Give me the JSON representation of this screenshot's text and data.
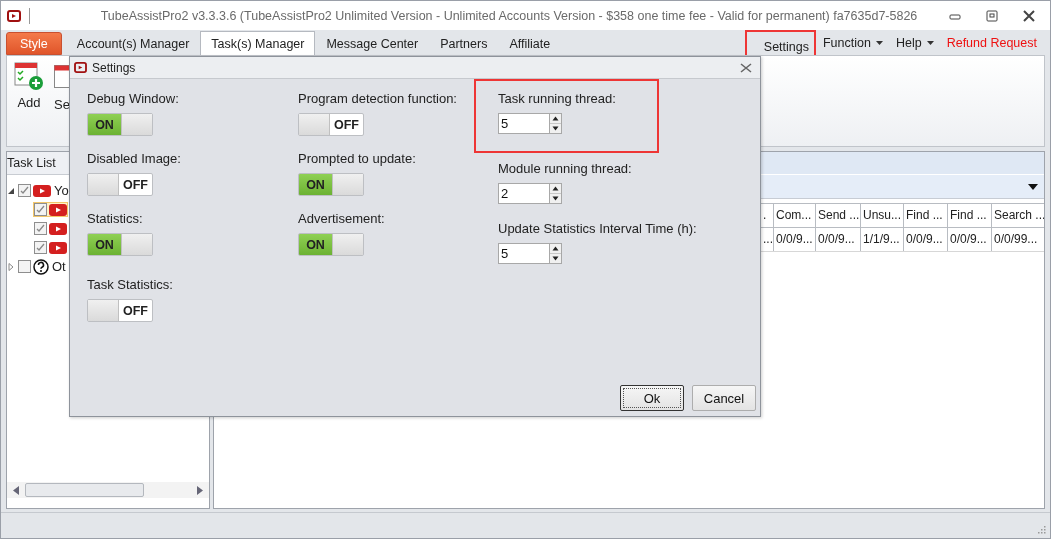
{
  "window": {
    "title": "TubeAssistPro2 v3.3.3.6 (TubeAssistPro2 Unlimited Version - Unlimited Accounts Version - $358 one time fee - Valid for permanent) fa7635d7-5826"
  },
  "app_menu": {
    "label": "Style"
  },
  "tabs": [
    {
      "label": "Account(s) Manager",
      "kind": "normal",
      "selected": false
    },
    {
      "label": "Task(s) Manager",
      "kind": "normal",
      "selected": true
    },
    {
      "label": "Message Center",
      "kind": "normal",
      "selected": false
    },
    {
      "label": "Partners",
      "kind": "normal",
      "selected": false
    },
    {
      "label": "Affiliate",
      "kind": "normal",
      "selected": false
    }
  ],
  "menu": [
    {
      "label": "Settings",
      "kind": "plain",
      "highlighted": true
    },
    {
      "label": "Function",
      "kind": "dropdown",
      "highlighted": false
    },
    {
      "label": "Help",
      "kind": "dropdown",
      "highlighted": false
    },
    {
      "label": "Refund Request",
      "kind": "alert",
      "highlighted": false
    }
  ],
  "ribbon": {
    "buttons": [
      {
        "label": "Add",
        "kind": "add"
      },
      {
        "label": "Se",
        "kind": "other"
      }
    ]
  },
  "task_list": {
    "title": "Task List",
    "items": [
      {
        "label": "Yo",
        "kind": "video",
        "checked": true,
        "expanded": true,
        "selected": false,
        "children": [
          {
            "kind": "video",
            "checked": true,
            "selected": true
          },
          {
            "kind": "video",
            "checked": true,
            "selected": false
          },
          {
            "kind": "video",
            "checked": true,
            "selected": false
          }
        ]
      },
      {
        "label": "Ot",
        "kind": "unknown",
        "checked": false,
        "expanded": false,
        "selected": false
      }
    ]
  },
  "table": {
    "columns": [
      ".",
      "Com...",
      "Send ...",
      "Unsu...",
      "Find ...",
      "Find ...",
      "Search ..."
    ],
    "rows": [
      [
        "...",
        "0/0/9...",
        "0/0/9...",
        "1/1/9...",
        "0/0/9...",
        "0/0/9...",
        "0/0/99..."
      ]
    ]
  },
  "dialog": {
    "title": "Settings",
    "columns": [
      [
        {
          "kind": "toggle",
          "label": "Debug Window:",
          "on": true,
          "state_text": "ON"
        },
        {
          "kind": "toggle",
          "label": "Disabled Image:",
          "on": false,
          "state_text": "OFF"
        },
        {
          "kind": "toggle",
          "label": "Statistics:",
          "on": true,
          "state_text": "ON"
        },
        {
          "kind": "toggle",
          "label": "Task Statistics:",
          "on": false,
          "state_text": "OFF"
        }
      ],
      [
        {
          "kind": "toggle",
          "label": "Program detection function:",
          "on": false,
          "state_text": "OFF"
        },
        {
          "kind": "toggle",
          "label": "Prompted to update:",
          "on": true,
          "state_text": "ON"
        },
        {
          "kind": "toggle",
          "label": "Advertisement:",
          "on": true,
          "state_text": "ON"
        }
      ],
      [
        {
          "kind": "spin",
          "label": "Task running thread:",
          "value": "5",
          "highlighted": true
        },
        {
          "kind": "spin",
          "label": "Module running thread:",
          "value": "2",
          "highlighted": false
        },
        {
          "kind": "spin",
          "label": "Update Statistics Interval Time (h):",
          "value": "5",
          "highlighted": false
        }
      ]
    ],
    "buttons": [
      {
        "label": "Ok",
        "default": true
      },
      {
        "label": "Cancel",
        "default": false
      }
    ]
  }
}
